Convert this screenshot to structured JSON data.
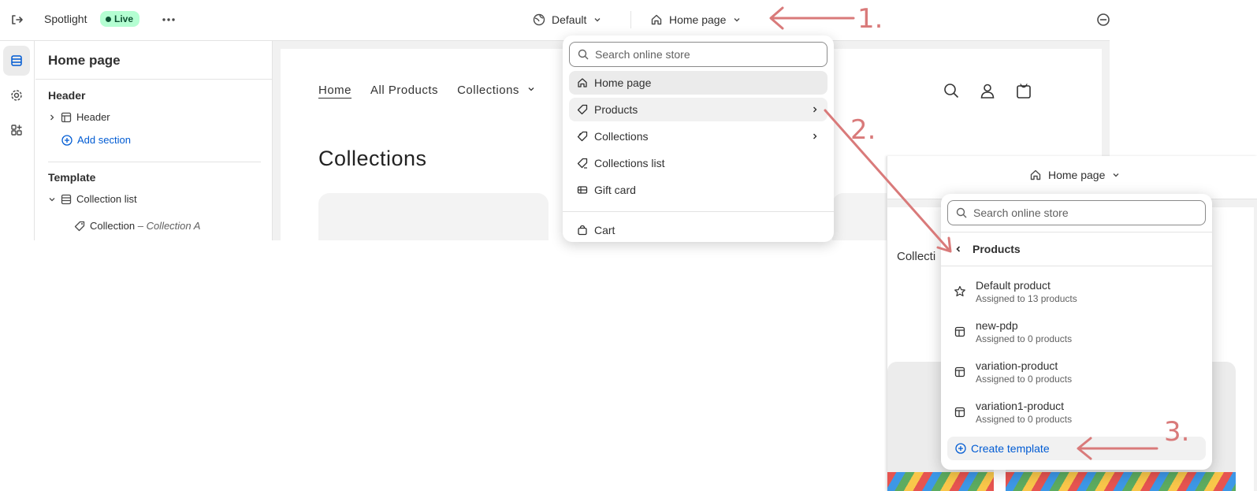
{
  "topbar": {
    "app_name": "Spotlight",
    "status": "Live",
    "theme_selector": "Default",
    "page_selector": "Home page"
  },
  "sidebar": {
    "title": "Home page",
    "header_section_title": "Header",
    "header_item": "Header",
    "add_section": "Add section",
    "template_section_title": "Template",
    "collection_list": "Collection list",
    "collection_item": "Collection",
    "collection_item_sep": " – ",
    "collection_item_name": "Collection A"
  },
  "preview": {
    "nav": [
      "Home",
      "All Products",
      "Collections"
    ],
    "heading": "Collections"
  },
  "dropdown": {
    "search_placeholder": "Search online store",
    "items": [
      "Home page",
      "Products",
      "Collections",
      "Collections list",
      "Gift card",
      "Cart"
    ]
  },
  "zoom": {
    "page_selector": "Home page",
    "search_placeholder": "Search online store",
    "back_label": "Products",
    "preview_text": "Collecti",
    "templates": [
      {
        "name": "Default product",
        "sub": "Assigned to 13 products",
        "icon": "star-icon"
      },
      {
        "name": "new-pdp",
        "sub": "Assigned to 0 products",
        "icon": "template-icon"
      },
      {
        "name": "variation-product",
        "sub": "Assigned to 0 products",
        "icon": "template-icon"
      },
      {
        "name": "variation1-product",
        "sub": "Assigned to 0 products",
        "icon": "template-icon"
      }
    ],
    "create_template": "Create template"
  },
  "annotations": [
    "1.",
    "2.",
    "3."
  ],
  "colors": {
    "annotation": "#d97a7a",
    "link": "#005bd3",
    "live_badge": "#b4fed2"
  }
}
